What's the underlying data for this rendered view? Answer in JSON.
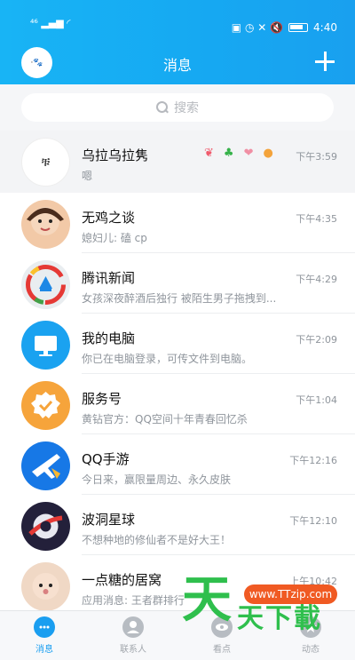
{
  "status_bar": {
    "signal": "⁴⁶ ▂▄▆ ◜",
    "icons_right": "▣ ◷ ✕ 🔇",
    "time": "4:40"
  },
  "header": {
    "title": "消息",
    "avatar_text": "·🐾"
  },
  "search": {
    "placeholder": "搜索"
  },
  "conversations": [
    {
      "name": "乌拉乌拉隽",
      "message": "嗯",
      "time": "下午3:59",
      "pinned": true,
      "badges": [
        "❦",
        "♣",
        "❤",
        "●"
      ],
      "avatar_text": "ቹ",
      "avatar_bg": "#ffffff"
    },
    {
      "name": "无鸡之谈",
      "message": "媳妇儿: 磕 cp",
      "time": "下午4:35",
      "avatar_text": "",
      "avatar_bg": "#f2c9a7"
    },
    {
      "name": "腾讯新闻",
      "message": "女孩深夜醉酒后独行 被陌生男子拖拽到...",
      "time": "下午4:29",
      "avatar_text": "",
      "avatar_bg": "#e9edf0"
    },
    {
      "name": "我的电脑",
      "message": "你已在电脑登录，可传文件到电脑。",
      "time": "下午2:09",
      "avatar_text": "▭",
      "avatar_bg": "#1aa2f0"
    },
    {
      "name": "服务号",
      "message": "黄钻官方：QQ空间十年青春回忆杀",
      "time": "下午1:04",
      "avatar_text": "✓",
      "avatar_bg": "#f6a43b"
    },
    {
      "name": "QQ手游",
      "message": "今日来，赢限量周边、永久皮肤",
      "time": "下午12:16",
      "avatar_text": "✈",
      "avatar_bg": "#1778e6"
    },
    {
      "name": "波洞星球",
      "message": "不想种地的修仙者不是好大王！",
      "time": "下午12:10",
      "avatar_text": "◉",
      "avatar_bg": "#23203a"
    },
    {
      "name": "一点糖的居窝",
      "message": "应用消息: 王者群排行",
      "time": "上午10:42",
      "avatar_text": "",
      "avatar_bg": "#f0d8c5"
    }
  ],
  "bottom_nav": [
    {
      "label": "消息",
      "active": true,
      "color": "#1a9ef0"
    },
    {
      "label": "联系人",
      "active": false,
      "color": "#b7bcc2"
    },
    {
      "label": "看点",
      "active": false,
      "color": "#b7bcc2"
    },
    {
      "label": "动态",
      "active": false,
      "color": "#b7bcc2"
    }
  ],
  "watermark": {
    "big": "天",
    "url": "www.TTzip.com",
    "text": "天下載"
  }
}
